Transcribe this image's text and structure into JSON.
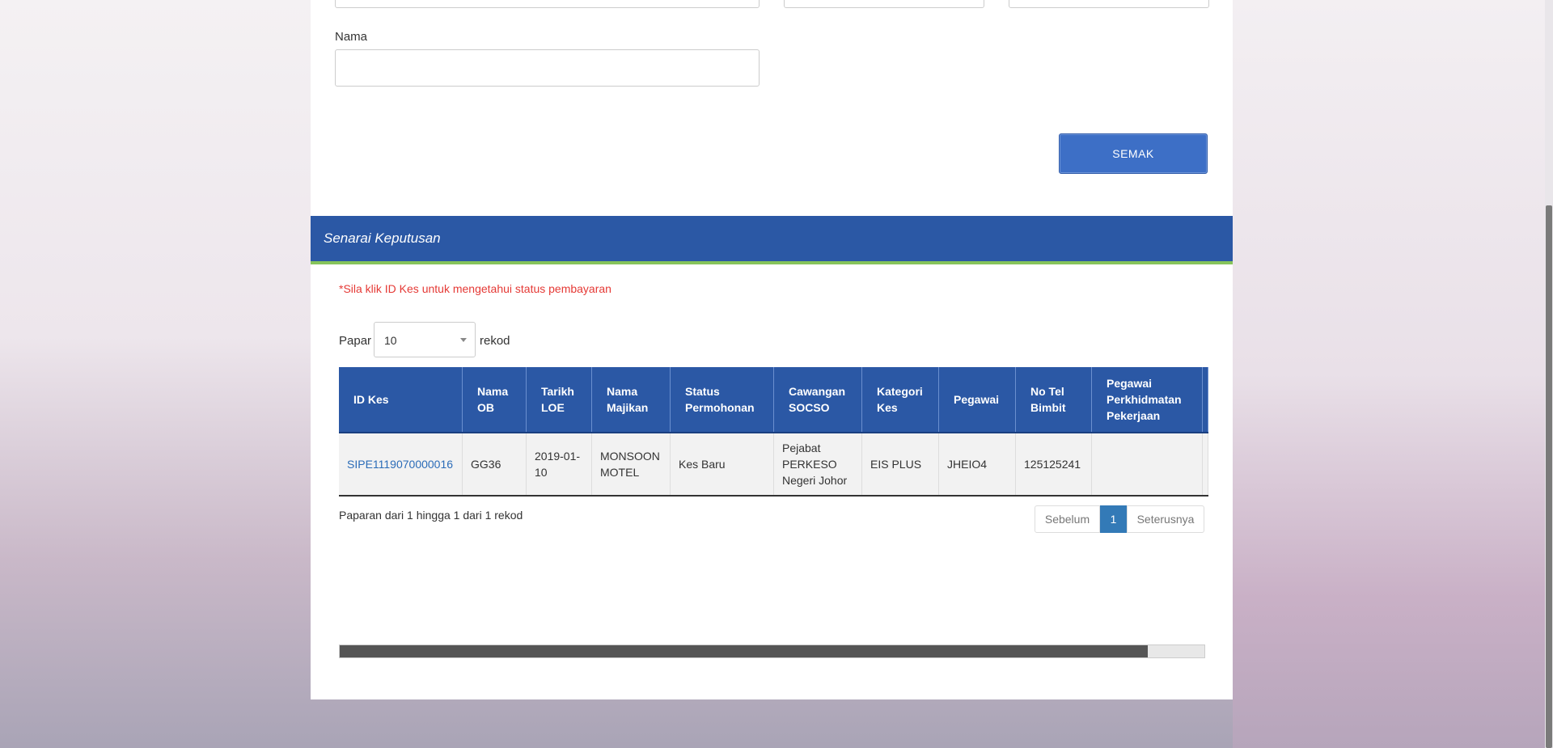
{
  "form": {
    "nama_label": "Nama",
    "nama_value": "",
    "semak_button": "SEMAK"
  },
  "section": {
    "title": "Senarai Keputusan",
    "note": "*Sila klik ID Kes untuk mengetahui status pembayaran"
  },
  "length_menu": {
    "prefix": "Papar",
    "selected": "10",
    "suffix": "rekod"
  },
  "table": {
    "headers": {
      "id_kes": "ID Kes",
      "nama_ob": "Nama OB",
      "tarikh_loe": "Tarikh LOE",
      "nama_majikan": "Nama Majikan",
      "status_permohonan": "Status Permohonan",
      "cawangan_socso": "Cawangan SOCSO",
      "kategori_kes": "Kategori Kes",
      "pegawai": "Pegawai",
      "no_tel_bimbit": "No Tel Bimbit",
      "pegawai_perkhidmatan": "Pegawai Perkhidmatan Pekerjaan"
    },
    "rows": [
      {
        "id_kes": "SIPE1119070000016",
        "nama_ob": "GG36",
        "tarikh_loe": "2019-01-10",
        "nama_majikan": "MONSOON MOTEL",
        "status_permohonan": "Kes Baru",
        "cawangan_socso": "Pejabat PERKESO Negeri Johor",
        "kategori_kes": "EIS PLUS",
        "pegawai": "JHEIO4",
        "no_tel_bimbit": "125125241",
        "pegawai_perkhidmatan": ""
      }
    ]
  },
  "pagination": {
    "info": "Paparan dari 1 hingga 1 dari 1 rekod",
    "prev": "Sebelum",
    "current": "1",
    "next": "Seterusnya"
  },
  "colors": {
    "header_blue": "#2b58a5",
    "accent_green": "#86c45b",
    "note_red": "#e53935",
    "link_blue": "#2b6cb8"
  }
}
